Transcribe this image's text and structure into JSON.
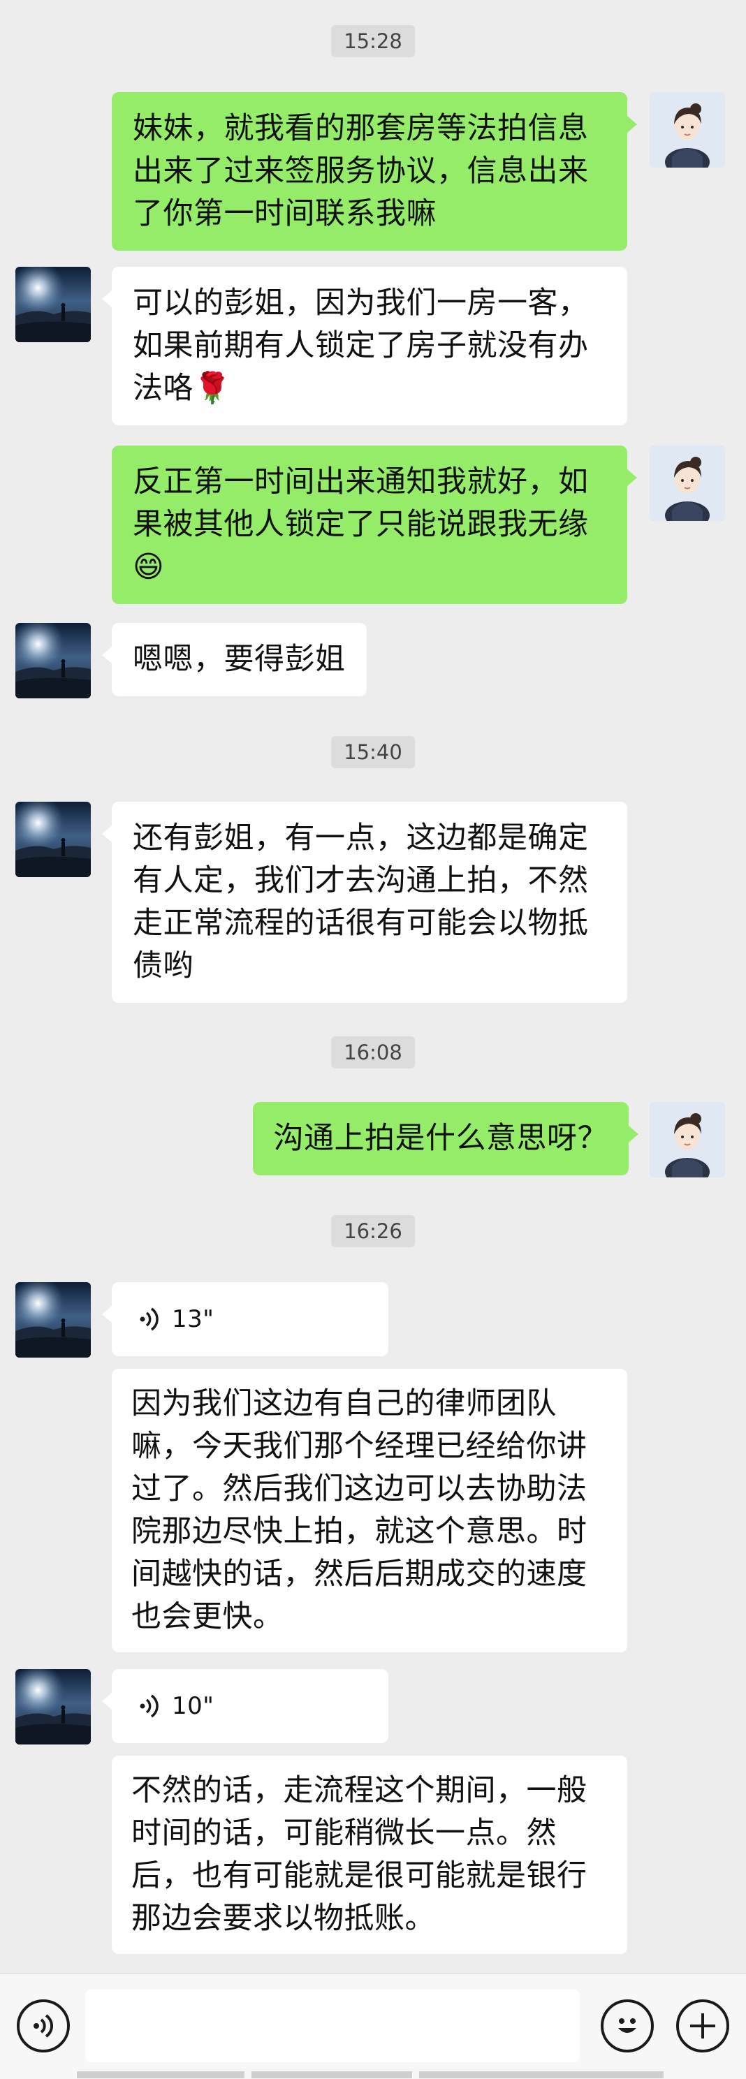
{
  "messages": {
    "ts1": "15:28",
    "m1": "妹妹，就我看的那套房等法拍信息出来了过来签服务协议，信息出来了你第一时间联系我嘛",
    "m2": "可以的彭姐，因为我们一房一客，如果前期有人锁定了房子就没有办法咯🌹",
    "m3": "反正第一时间出来通知我就好，如果被其他人锁定了只能说跟我无缘😄",
    "m4": "嗯嗯，要得彭姐",
    "ts2": "15:40",
    "m5": "还有彭姐，有一点，这边都是确定有人定，我们才去沟通上拍，不然走正常流程的话很有可能会以物抵债哟",
    "ts3": "16:08",
    "m6": "沟通上拍是什么意思呀？",
    "ts4": "16:26",
    "voice1": "13\"",
    "m7": "因为我们这边有自己的律师团队嘛，今天我们那个经理已经给你讲过了。然后我们这边可以去协助法院那边尽快上拍，就这个意思。时间越快的话，然后后期成交的速度也会更快。",
    "voice2": "10\"",
    "m8": "不然的话，走流程这个期间，一般时间的话，可能稍微长一点。然后，也有可能就是很可能就是银行那边会要求以物抵账。"
  },
  "input": {
    "value": ""
  },
  "icons": {
    "voice_toggle": "voice-icon",
    "emoji": "emoji-icon",
    "plus": "plus-icon"
  },
  "colors": {
    "background": "#ededed",
    "outgoing_bubble": "#95ec69",
    "incoming_bubble": "#ffffff",
    "timestamp_bg": "#dcdcdc"
  }
}
